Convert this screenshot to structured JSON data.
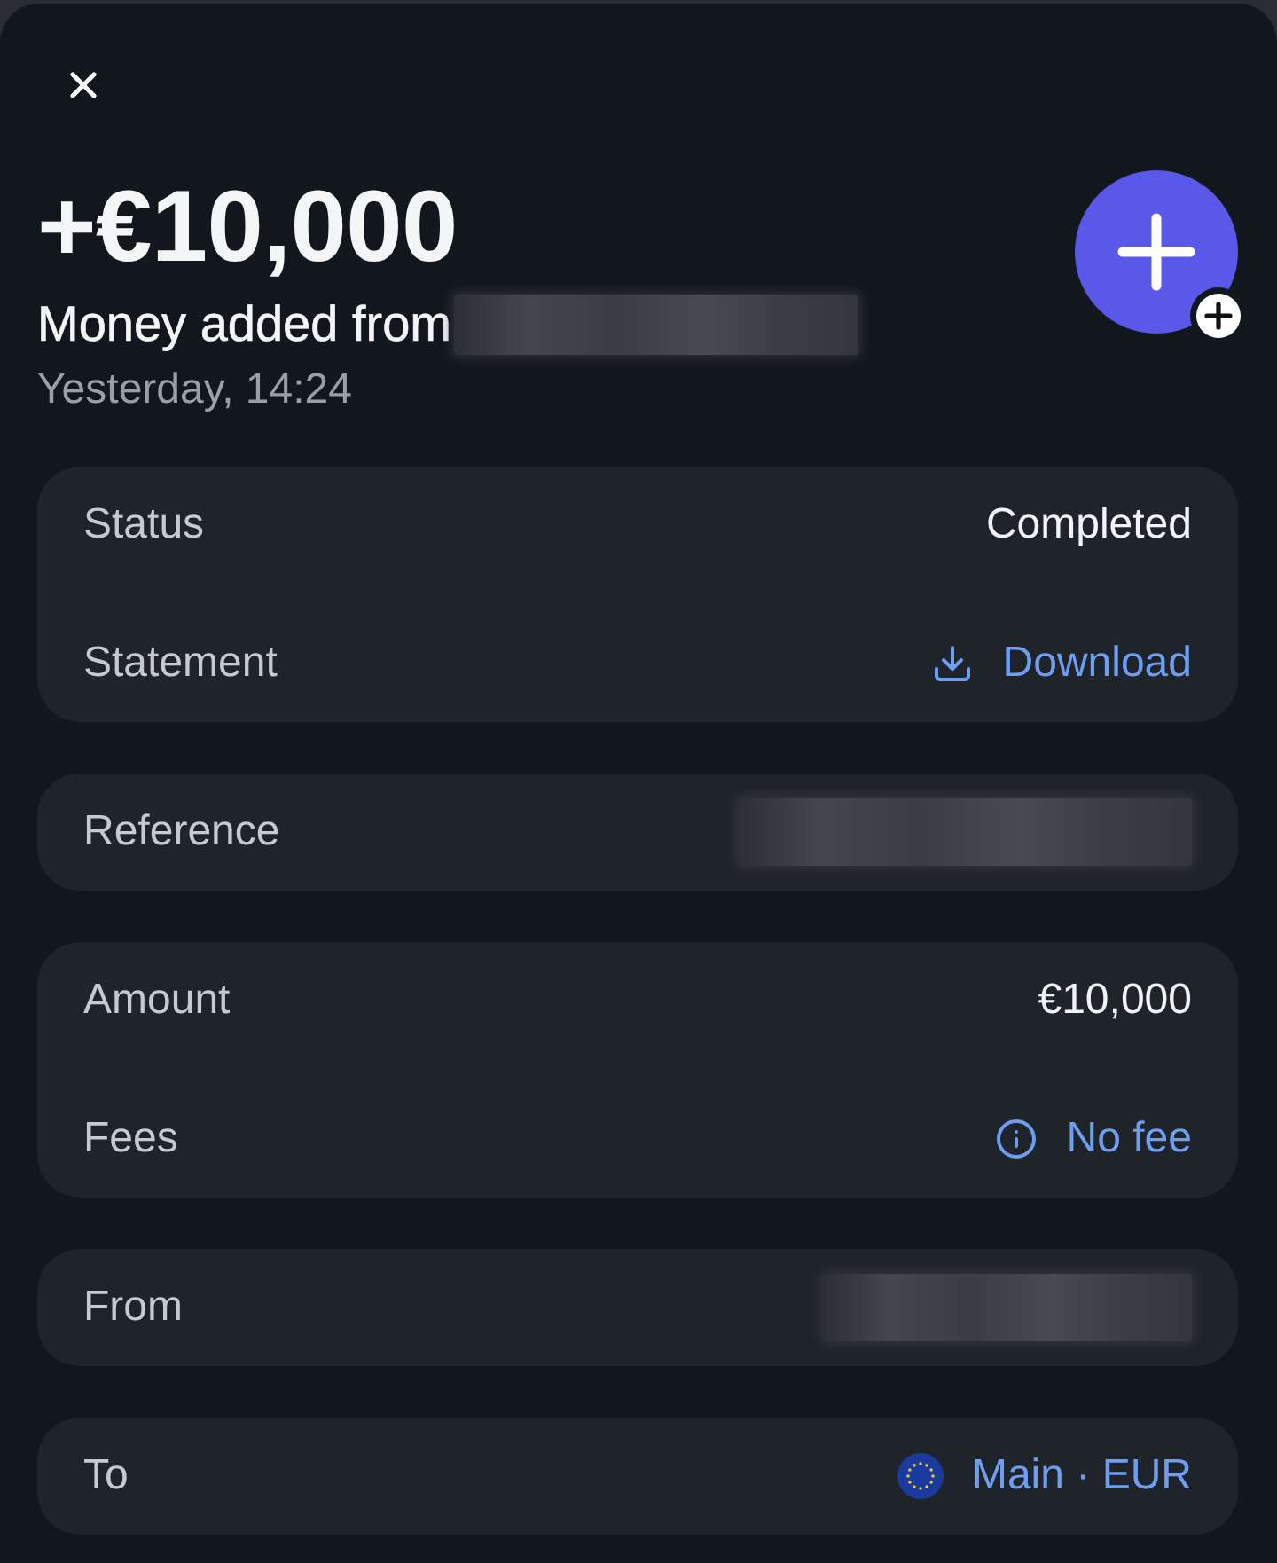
{
  "header": {
    "amount": "+€10,000",
    "description": "Money added from",
    "sender_redacted": true,
    "date": "Yesterday, 14:24"
  },
  "sections": [
    {
      "rows": [
        {
          "label": "Status",
          "kind": "text",
          "value": "Completed"
        },
        {
          "label": "Statement",
          "kind": "download",
          "value": "Download"
        }
      ]
    },
    {
      "rows": [
        {
          "label": "Reference",
          "kind": "redacted"
        }
      ]
    },
    {
      "rows": [
        {
          "label": "Amount",
          "kind": "text",
          "value": "€10,000"
        },
        {
          "label": "Fees",
          "kind": "info",
          "value": "No fee"
        }
      ]
    },
    {
      "rows": [
        {
          "label": "From",
          "kind": "redacted"
        }
      ]
    },
    {
      "rows": [
        {
          "label": "To",
          "kind": "account",
          "value": "Main · EUR"
        }
      ]
    }
  ]
}
